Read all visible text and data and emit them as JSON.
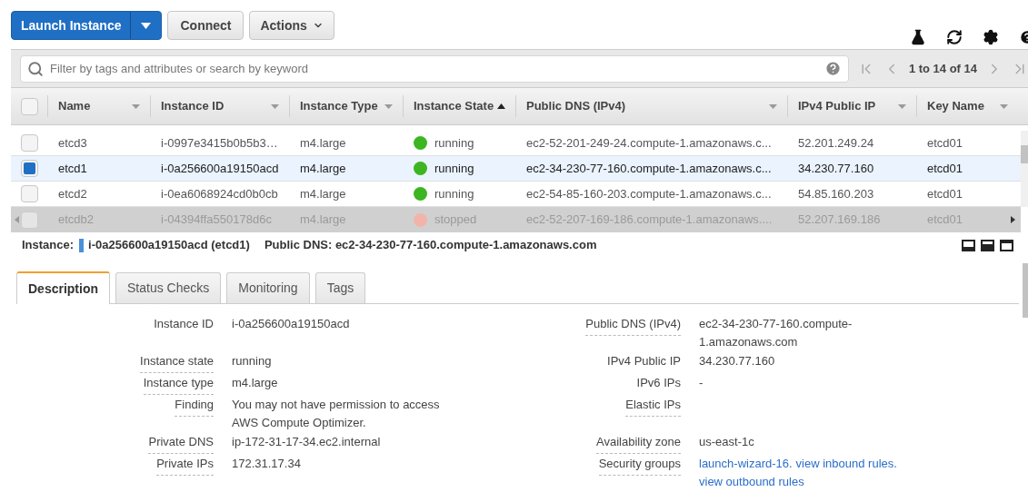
{
  "toolbar": {
    "buttons": [
      {
        "label": "Launch Instance",
        "kind": "primary"
      },
      {
        "label": "Connect",
        "kind": "plain"
      },
      {
        "label": "Actions",
        "kind": "menu"
      }
    ]
  },
  "filter": {
    "placeholder": "Filter by tags and attributes or search by keyword",
    "pagination": "1 to 14 of 14"
  },
  "table": {
    "select_all": {
      "checked": false
    },
    "columns": [
      {
        "label": "Name",
        "sorted": false
      },
      {
        "label": "Instance ID",
        "sorted": false
      },
      {
        "label": "Instance Type",
        "sorted": false
      },
      {
        "label": "Instance State",
        "sorted": true
      },
      {
        "label": "Public DNS (IPv4)",
        "sorted": false
      },
      {
        "label": "IPv4 Public IP",
        "sorted": false
      },
      {
        "label": "Key Name",
        "sorted": false
      }
    ],
    "rows": [
      {
        "selected": false,
        "cells": [
          "etcd3",
          "i-0997e3415b0b5b3…",
          "m4.large",
          "running",
          "ec2-52-201-249-24.compute-1.amazonaws.c...",
          "52.201.249.24",
          "etcd01"
        ],
        "color": "#3cb521"
      },
      {
        "selected": true,
        "cells": [
          "etcd1",
          "i-0a256600a19150acd",
          "m4.large",
          "running",
          "ec2-34-230-77-160.compute-1.amazonaws.c...",
          "34.230.77.160",
          "etcd01"
        ],
        "color": "#3cb521"
      },
      {
        "selected": false,
        "cells": [
          "etcd2",
          "i-0ea6068924cd0b0cb",
          "m4.large",
          "running",
          "ec2-54-85-160-203.compute-1.amazonaws.c...",
          "54.85.160.203",
          "etcd01"
        ],
        "color": "#3cb521"
      },
      {
        "selected": false,
        "cells": [
          "etcdb2",
          "i-04394ffa550178d6c",
          "m4.large",
          "stopped",
          "ec2-52-207-169-186.compute-1.amazonaws....",
          "52.207.169.186",
          "etcd01"
        ],
        "color": "#f2b4aa"
      }
    ]
  },
  "detail_header": {
    "instance_label": "Instance:",
    "instance": "i-0a256600a19150acd (etcd1)",
    "dns": "Public DNS: ec2-34-230-77-160.compute-1.amazonaws.com"
  },
  "tabs": [
    {
      "label": "Description",
      "selected": true
    },
    {
      "label": "Status Checks",
      "selected": false
    },
    {
      "label": "Monitoring",
      "selected": false
    },
    {
      "label": "Tags",
      "selected": false
    }
  ],
  "details": [
    {
      "left": {
        "label": "Instance ID",
        "value": "i-0a256600a19150acd",
        "tooltip": false
      },
      "right": {
        "label": "Public DNS (IPv4)",
        "value": "ec2-34-230-77-160.compute-1.amazonaws.com",
        "tooltip": true
      }
    },
    {
      "left": {
        "label": "Instance state",
        "value": "running",
        "tooltip": true
      },
      "right": {
        "label": "IPv4 Public IP",
        "value": "34.230.77.160",
        "tooltip": false
      }
    },
    {
      "left": {
        "label": "Instance type",
        "value": "m4.large",
        "tooltip": true
      },
      "right": {
        "label": "IPv6 IPs",
        "value": "-",
        "tooltip": false
      }
    },
    {
      "left": {
        "label": "Finding",
        "value": "You may not have permission to access AWS Compute Optimizer.",
        "tooltip": true
      },
      "right": {
        "label": "Elastic IPs",
        "tooltip": true
      }
    },
    {
      "left": {
        "label": "Private DNS",
        "value": "ip-172-31-17-34.ec2.internal",
        "tooltip": true
      },
      "right": {
        "label": "Availability zone",
        "value": "us-east-1c",
        "tooltip": true
      }
    },
    {
      "left": {
        "label": "Private IPs",
        "value": "172.31.17.34",
        "tooltip": true
      },
      "right": {
        "label": "Security groups",
        "links": [
          "launch-wizard-16.",
          "view inbound rules.",
          "view outbound rules"
        ],
        "tooltip": true
      }
    }
  ]
}
